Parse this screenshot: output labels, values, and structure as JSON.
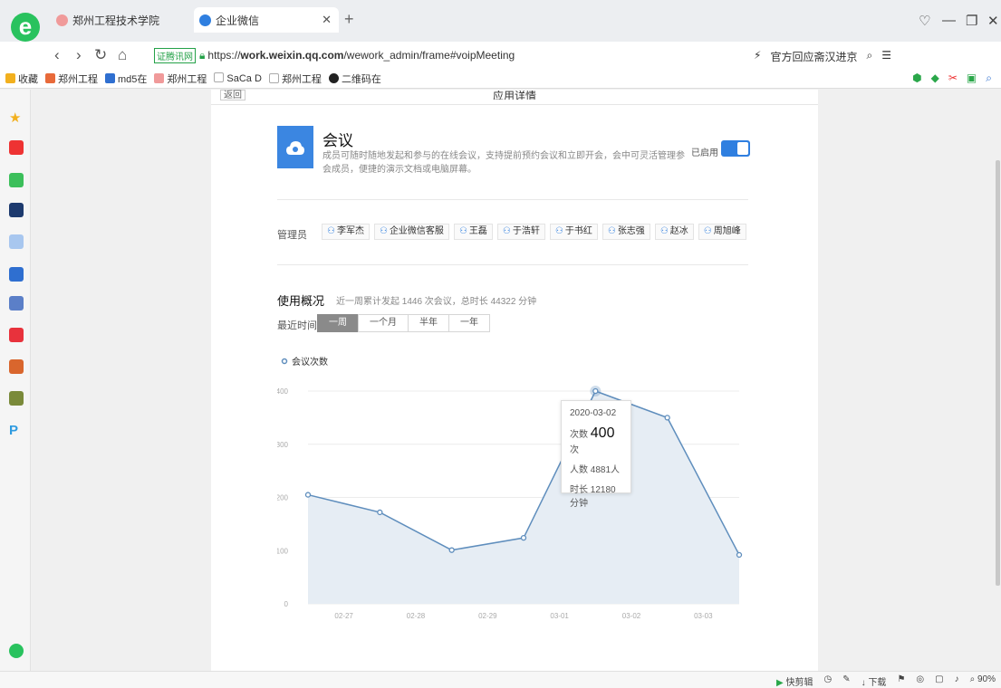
{
  "browser": {
    "tabs": [
      {
        "label": "郑州工程技术学院",
        "icon_color": "#f09a9a"
      },
      {
        "label": "企业微信",
        "icon_color": "#2f7fe0"
      }
    ],
    "url_cert": "证腾讯网",
    "url_prefix": "https://",
    "url_host": "work.weixin.qq.com",
    "url_path": "/wework_admin/frame#voipMeeting",
    "news_hint": "官方回应斋汉进京",
    "bookmarks": [
      {
        "label": "收藏",
        "icon_color": "#f2b01e"
      },
      {
        "label": "郑州工程",
        "icon_color": "#e86a3a"
      },
      {
        "label": "md5在",
        "icon_color": "#2f6fd0"
      },
      {
        "label": "郑州工程",
        "icon_color": "#f09a9a"
      },
      {
        "label": "SaCa D",
        "icon_color": "#cccccc"
      },
      {
        "label": "郑州工程",
        "icon_color": "#cccccc"
      },
      {
        "label": "二维码在",
        "icon_color": "#222222"
      }
    ]
  },
  "page": {
    "back_label": "返回",
    "header_title": "应用详情",
    "app": {
      "name": "会议",
      "description": "成员可随时随地发起和参与的在线会议，支持提前预约会议和立即开会，会中可灵活管理参会成员，便捷的演示文档或电脑屏幕。",
      "status_label": "已启用",
      "enabled": true,
      "icon_color": "#3b86e1"
    },
    "admins_label": "管理员",
    "admins": [
      "李军杰",
      "企业微信客服",
      "王磊",
      "于浩轩",
      "于书红",
      "张志强",
      "赵冰",
      "周旭峰"
    ],
    "usage": {
      "title": "使用概况",
      "summary": "近一周累计发起 1446 次会议，总时长 44322 分钟",
      "range_label": "最近时间:",
      "ranges": [
        "一周",
        "一个月",
        "半年",
        "一年"
      ],
      "active_range": 0
    },
    "tooltip": {
      "date": "2020-03-02",
      "count_label": "次数",
      "count_value": "400",
      "count_unit": "次",
      "people": "人数  4881人",
      "duration": "时长  12180分钟"
    }
  },
  "chart_data": {
    "type": "area",
    "legend": "会议次数",
    "legend_position": "top-left",
    "x": [
      "02-27",
      "02-28",
      "02-29",
      "03-01",
      "03-02",
      "03-03"
    ],
    "points": [
      {
        "x": 0.0,
        "y": 205
      },
      {
        "x": 1.0,
        "y": 172
      },
      {
        "x": 2.0,
        "y": 101
      },
      {
        "x": 3.0,
        "y": 124
      },
      {
        "x": 4.0,
        "y": 400
      },
      {
        "x": 5.0,
        "y": 350
      },
      {
        "x": 6.0,
        "y": 92
      }
    ],
    "ylim": [
      0,
      400
    ],
    "yticks": [
      0,
      100,
      200,
      300,
      400
    ],
    "grid": true,
    "line_color": "#5f8ebd",
    "area_color": "#e6edf4"
  },
  "status_bar": [
    "快剪辑",
    "下载",
    "90%"
  ]
}
